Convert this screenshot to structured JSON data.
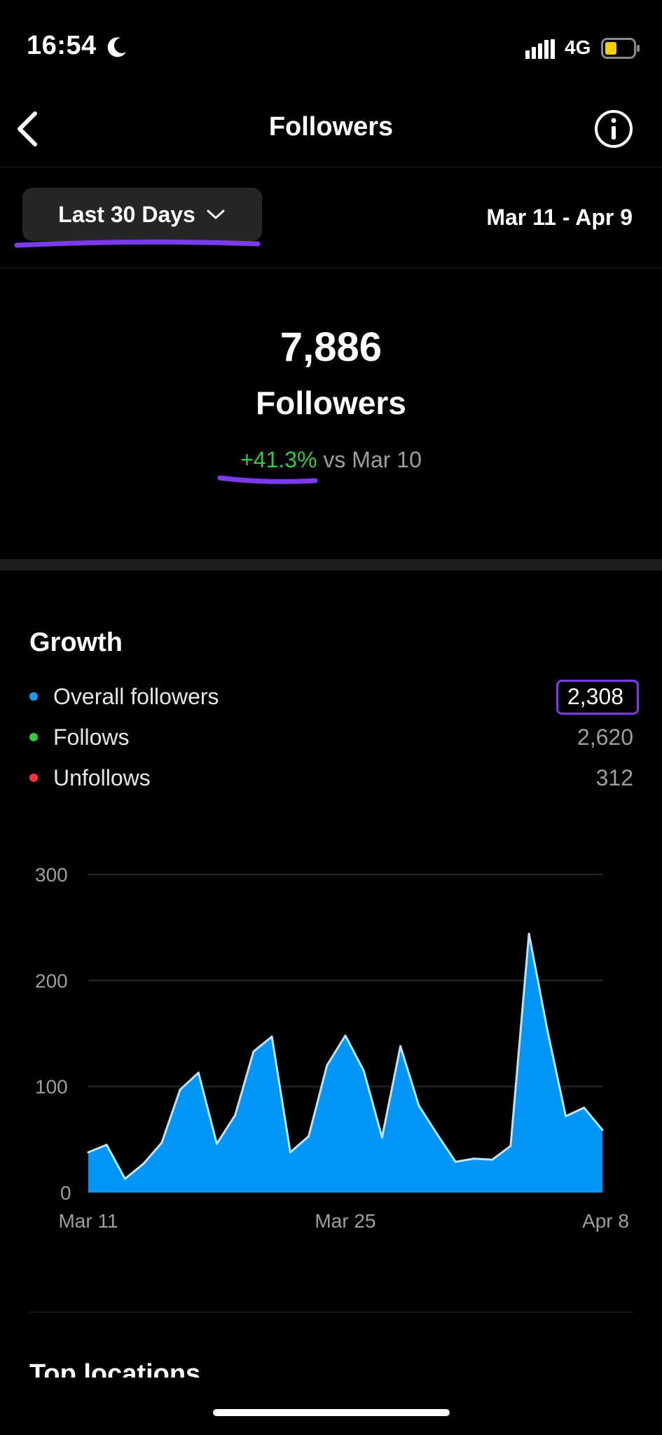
{
  "status_bar": {
    "time": "16:54",
    "network": "4G",
    "icons": [
      "moon-icon",
      "signal-icon",
      "battery-icon"
    ]
  },
  "header": {
    "title": "Followers",
    "icons": [
      "back-chevron-icon",
      "info-icon"
    ]
  },
  "filter": {
    "range_label": "Last 30 Days",
    "date_range": "Mar 11 - Apr 9"
  },
  "summary": {
    "count": "7,886",
    "label": "Followers",
    "change": "+41.3%",
    "comparison": "vs Mar 10",
    "positive_color": "#2ecc40"
  },
  "growth": {
    "title": "Growth",
    "legend": [
      {
        "label": "Overall followers",
        "value": "2,308",
        "color": "#1d9bf0"
      },
      {
        "label": "Follows",
        "value": "2,620",
        "color": "#2ecc40"
      },
      {
        "label": "Unfollows",
        "value": "312",
        "color": "#ff3040"
      }
    ]
  },
  "chart_data": {
    "type": "area",
    "x": [
      "Mar 11",
      "Mar 12",
      "Mar 13",
      "Mar 14",
      "Mar 15",
      "Mar 16",
      "Mar 17",
      "Mar 18",
      "Mar 19",
      "Mar 20",
      "Mar 21",
      "Mar 22",
      "Mar 23",
      "Mar 24",
      "Mar 25",
      "Mar 26",
      "Mar 27",
      "Mar 28",
      "Mar 29",
      "Mar 30",
      "Mar 31",
      "Apr 1",
      "Apr 2",
      "Apr 3",
      "Apr 4",
      "Apr 5",
      "Apr 6",
      "Apr 7",
      "Apr 8"
    ],
    "values": [
      38,
      45,
      13,
      27,
      47,
      97,
      113,
      46,
      73,
      133,
      147,
      38,
      53,
      120,
      148,
      115,
      52,
      138,
      82,
      55,
      29,
      32,
      31,
      44,
      244,
      153,
      72,
      80,
      59
    ],
    "x_tick_labels": [
      "Mar 11",
      "Mar 25",
      "Apr 8"
    ],
    "y_tick_labels": [
      "0",
      "100",
      "200",
      "300"
    ],
    "ylim": [
      0,
      300
    ],
    "grid": true,
    "color": "#0095f6"
  },
  "next_section": {
    "title": "Top locations"
  },
  "annotation_color": "#7c3aed"
}
